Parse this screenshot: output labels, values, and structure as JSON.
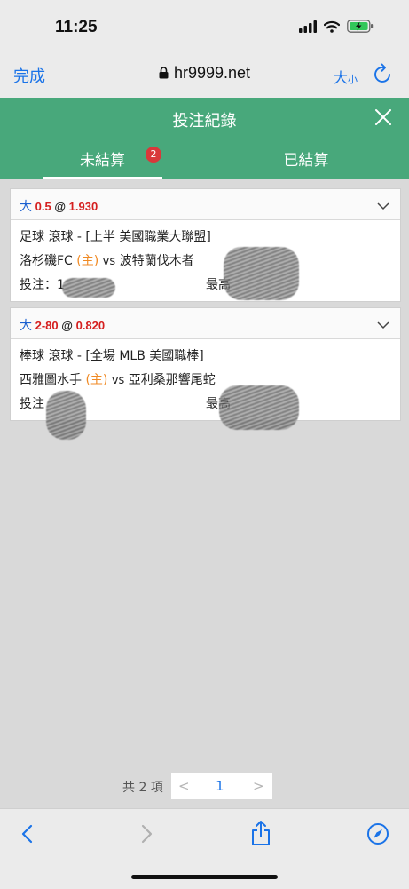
{
  "status_bar": {
    "time": "11:25"
  },
  "browser": {
    "done_label": "完成",
    "url": "hr9999.net",
    "text_size_big": "大",
    "text_size_small": "小"
  },
  "header": {
    "title": "投注紀錄",
    "tabs": [
      {
        "label": "未結算",
        "badge": "2"
      },
      {
        "label": "已結算"
      }
    ]
  },
  "bets": [
    {
      "pick": "大",
      "line": "0.5",
      "at": "@",
      "odds": "1.930",
      "sport_line": "足球 滾球 - [上半 美國職業大聯盟]",
      "home_team": "洛杉磯FC",
      "home_tag": "(主)",
      "vs": "vs",
      "away_team": "波特蘭伐木者",
      "stake_label": "投注：",
      "stake_visible": "1",
      "max_label": "最高"
    },
    {
      "pick": "大",
      "line": "2-80",
      "at": "@",
      "odds": "0.820",
      "sport_line": "棒球 滾球 - [全場 MLB 美國職棒]",
      "home_team": "西雅圖水手",
      "home_tag": "(主)",
      "vs": "vs",
      "away_team": "亞利桑那響尾蛇",
      "stake_label": "投注",
      "max_label": "最高"
    }
  ],
  "pagination": {
    "total_text": "共 2 項",
    "prev": "<",
    "current": "1",
    "next": ">"
  },
  "colors": {
    "header_green": "#48a87b",
    "accent_blue": "#1a73e8",
    "odds_red": "#d51f1f",
    "home_orange": "#f08a24",
    "badge_red": "#d9383a"
  }
}
